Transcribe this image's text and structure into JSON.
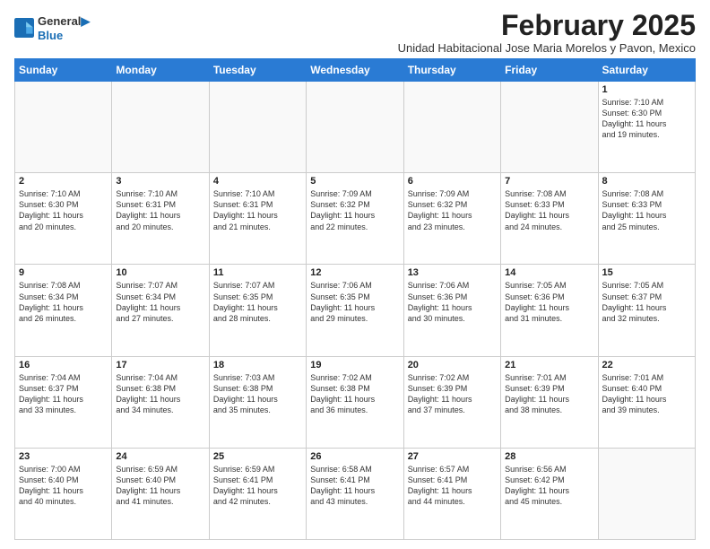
{
  "logo": {
    "line1": "General",
    "line2": "Blue"
  },
  "title": "February 2025",
  "location": "Unidad Habitacional Jose Maria Morelos y Pavon, Mexico",
  "days_of_week": [
    "Sunday",
    "Monday",
    "Tuesday",
    "Wednesday",
    "Thursday",
    "Friday",
    "Saturday"
  ],
  "weeks": [
    [
      {
        "day": "",
        "content": ""
      },
      {
        "day": "",
        "content": ""
      },
      {
        "day": "",
        "content": ""
      },
      {
        "day": "",
        "content": ""
      },
      {
        "day": "",
        "content": ""
      },
      {
        "day": "",
        "content": ""
      },
      {
        "day": "1",
        "content": "Sunrise: 7:10 AM\nSunset: 6:30 PM\nDaylight: 11 hours\nand 19 minutes."
      }
    ],
    [
      {
        "day": "2",
        "content": "Sunrise: 7:10 AM\nSunset: 6:30 PM\nDaylight: 11 hours\nand 20 minutes."
      },
      {
        "day": "3",
        "content": "Sunrise: 7:10 AM\nSunset: 6:31 PM\nDaylight: 11 hours\nand 20 minutes."
      },
      {
        "day": "4",
        "content": "Sunrise: 7:10 AM\nSunset: 6:31 PM\nDaylight: 11 hours\nand 21 minutes."
      },
      {
        "day": "5",
        "content": "Sunrise: 7:09 AM\nSunset: 6:32 PM\nDaylight: 11 hours\nand 22 minutes."
      },
      {
        "day": "6",
        "content": "Sunrise: 7:09 AM\nSunset: 6:32 PM\nDaylight: 11 hours\nand 23 minutes."
      },
      {
        "day": "7",
        "content": "Sunrise: 7:08 AM\nSunset: 6:33 PM\nDaylight: 11 hours\nand 24 minutes."
      },
      {
        "day": "8",
        "content": "Sunrise: 7:08 AM\nSunset: 6:33 PM\nDaylight: 11 hours\nand 25 minutes."
      }
    ],
    [
      {
        "day": "9",
        "content": "Sunrise: 7:08 AM\nSunset: 6:34 PM\nDaylight: 11 hours\nand 26 minutes."
      },
      {
        "day": "10",
        "content": "Sunrise: 7:07 AM\nSunset: 6:34 PM\nDaylight: 11 hours\nand 27 minutes."
      },
      {
        "day": "11",
        "content": "Sunrise: 7:07 AM\nSunset: 6:35 PM\nDaylight: 11 hours\nand 28 minutes."
      },
      {
        "day": "12",
        "content": "Sunrise: 7:06 AM\nSunset: 6:35 PM\nDaylight: 11 hours\nand 29 minutes."
      },
      {
        "day": "13",
        "content": "Sunrise: 7:06 AM\nSunset: 6:36 PM\nDaylight: 11 hours\nand 30 minutes."
      },
      {
        "day": "14",
        "content": "Sunrise: 7:05 AM\nSunset: 6:36 PM\nDaylight: 11 hours\nand 31 minutes."
      },
      {
        "day": "15",
        "content": "Sunrise: 7:05 AM\nSunset: 6:37 PM\nDaylight: 11 hours\nand 32 minutes."
      }
    ],
    [
      {
        "day": "16",
        "content": "Sunrise: 7:04 AM\nSunset: 6:37 PM\nDaylight: 11 hours\nand 33 minutes."
      },
      {
        "day": "17",
        "content": "Sunrise: 7:04 AM\nSunset: 6:38 PM\nDaylight: 11 hours\nand 34 minutes."
      },
      {
        "day": "18",
        "content": "Sunrise: 7:03 AM\nSunset: 6:38 PM\nDaylight: 11 hours\nand 35 minutes."
      },
      {
        "day": "19",
        "content": "Sunrise: 7:02 AM\nSunset: 6:38 PM\nDaylight: 11 hours\nand 36 minutes."
      },
      {
        "day": "20",
        "content": "Sunrise: 7:02 AM\nSunset: 6:39 PM\nDaylight: 11 hours\nand 37 minutes."
      },
      {
        "day": "21",
        "content": "Sunrise: 7:01 AM\nSunset: 6:39 PM\nDaylight: 11 hours\nand 38 minutes."
      },
      {
        "day": "22",
        "content": "Sunrise: 7:01 AM\nSunset: 6:40 PM\nDaylight: 11 hours\nand 39 minutes."
      }
    ],
    [
      {
        "day": "23",
        "content": "Sunrise: 7:00 AM\nSunset: 6:40 PM\nDaylight: 11 hours\nand 40 minutes."
      },
      {
        "day": "24",
        "content": "Sunrise: 6:59 AM\nSunset: 6:40 PM\nDaylight: 11 hours\nand 41 minutes."
      },
      {
        "day": "25",
        "content": "Sunrise: 6:59 AM\nSunset: 6:41 PM\nDaylight: 11 hours\nand 42 minutes."
      },
      {
        "day": "26",
        "content": "Sunrise: 6:58 AM\nSunset: 6:41 PM\nDaylight: 11 hours\nand 43 minutes."
      },
      {
        "day": "27",
        "content": "Sunrise: 6:57 AM\nSunset: 6:41 PM\nDaylight: 11 hours\nand 44 minutes."
      },
      {
        "day": "28",
        "content": "Sunrise: 6:56 AM\nSunset: 6:42 PM\nDaylight: 11 hours\nand 45 minutes."
      },
      {
        "day": "",
        "content": ""
      }
    ]
  ]
}
